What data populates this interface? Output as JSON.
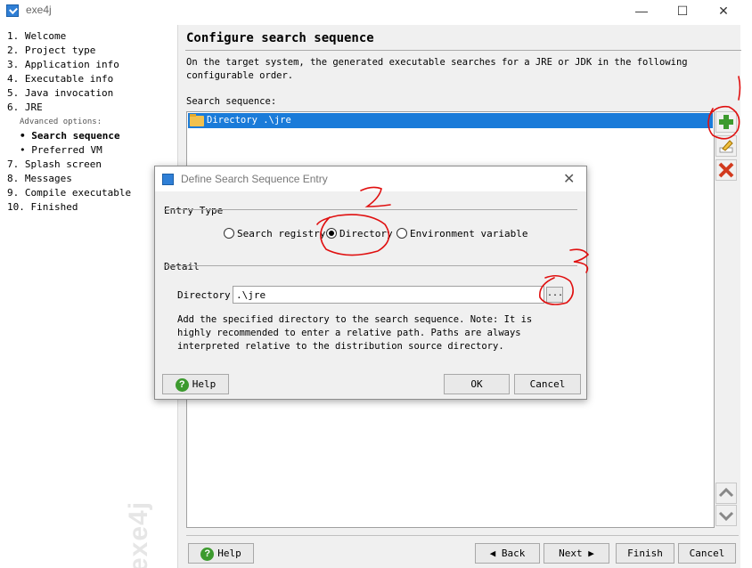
{
  "window": {
    "title": "exe4j",
    "minimize": "—",
    "maximize": "☐",
    "close": "✕"
  },
  "steps": [
    "1. Welcome",
    "2. Project type",
    "3. Application info",
    "4. Executable info",
    "5. Java invocation",
    "6. JRE",
    "Advanced options:",
    "• Search sequence",
    "• Preferred VM",
    "7. Splash screen",
    "8. Messages",
    "9. Compile executable",
    "10. Finished"
  ],
  "watermark": "exe4j",
  "main": {
    "title": "Configure search sequence",
    "description": "On the target system, the generated executable searches for a JRE or JDK in the following configurable order.",
    "seq_label": "Search sequence:",
    "seq_items": [
      "Directory .\\jre"
    ]
  },
  "buttons": {
    "help": "Help",
    "back": "Back",
    "next": "Next",
    "finish": "Finish",
    "cancel": "Cancel"
  },
  "dialog": {
    "title": "Define Search Sequence Entry",
    "entry_type_label": "Entry Type",
    "options": [
      "Search registry",
      "Directory",
      "Environment variable"
    ],
    "selected": "Directory",
    "detail_label": "Detail",
    "directory_label": "Directory:",
    "directory_value": ".\\jre",
    "browse": "...",
    "description": "Add the specified directory to the search sequence. Note: It is highly recommended to enter a relative path. Paths are always interpreted relative to the distribution source directory.",
    "help": "Help",
    "ok": "OK",
    "cancel": "Cancel"
  },
  "annotations": [
    "1",
    "2",
    "3"
  ],
  "colors": {
    "selection": "#1a7bd9",
    "annotation": "#e01010",
    "add": "#3c9a2e",
    "remove": "#d23a1e"
  }
}
